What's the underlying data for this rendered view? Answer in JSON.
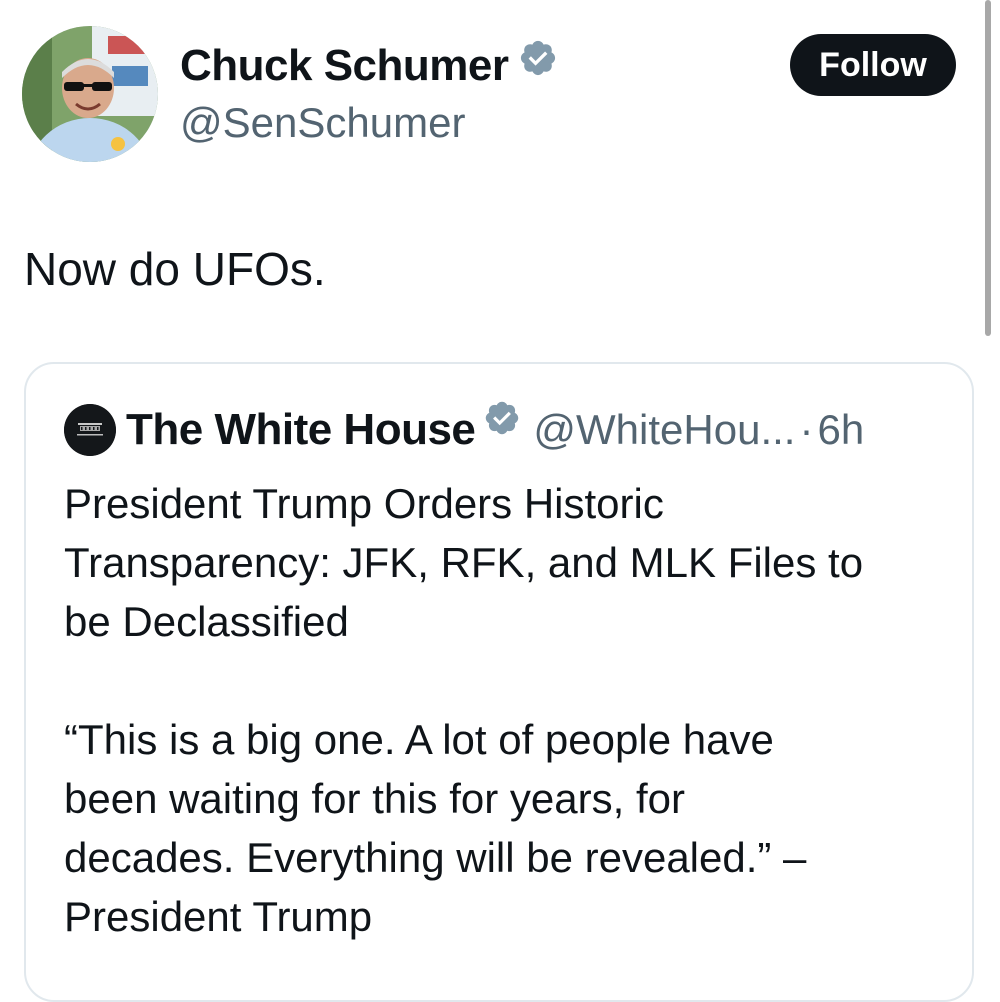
{
  "tweet": {
    "author": {
      "name": "Chuck Schumer",
      "handle": "@SenSchumer",
      "verified": true,
      "avatar_icon": "profile-photo"
    },
    "follow_label": "Follow",
    "text": "Now do UFOs."
  },
  "quoted_tweet": {
    "author": {
      "name": "The White House",
      "handle": "@WhiteHou...",
      "verified": true,
      "avatar_icon": "white-house-logo"
    },
    "separator": "·",
    "time": "6h",
    "paragraphs": [
      "President Trump Orders Historic\nTransparency: JFK, RFK, and MLK Files to\nbe Declassified",
      "“This is a big one. A lot of people have\nbeen waiting for this for years, for\ndecades. Everything will be revealed.” –\nPresident Trump"
    ]
  },
  "colors": {
    "text_primary": "#0f1419",
    "text_secondary": "#536471",
    "verified_badge": "#829aab",
    "follow_button_bg": "#0f1419",
    "card_border": "#e1e8ed"
  }
}
